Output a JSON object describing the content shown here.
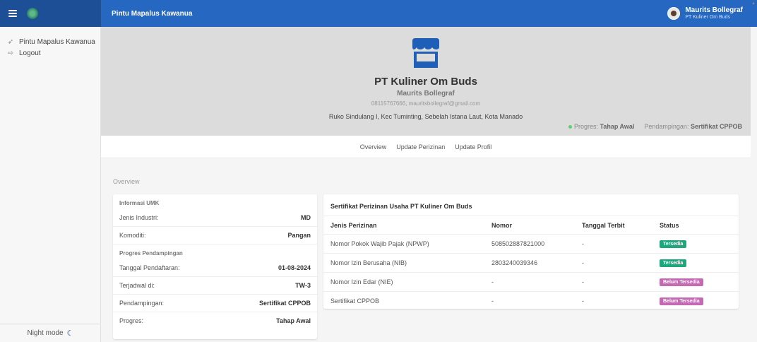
{
  "topbar": {
    "app_title": "Pintu Mapalus Kawanua",
    "user_name": "Maurits Bollegraf",
    "user_company": "PT Kuliner Om Buds"
  },
  "sidebar": {
    "items": [
      {
        "label": "Pintu Mapalus Kawanua",
        "icon": "rocket-icon"
      },
      {
        "label": "Logout",
        "icon": "logout-icon"
      }
    ],
    "night_mode": "Night mode"
  },
  "profile": {
    "company_name": "PT Kuliner Om Buds",
    "owner_name": "Maurits Bollegraf",
    "contact": "08115767666, mauritsbollegraf@gmail.com",
    "address": "Ruko Sindulang I, Kec Tuminting, Sebelah Istana Laut, Kota Manado",
    "progress_label": "Progres:",
    "progress_value": "Tahap Awal",
    "assist_label": "Pendampingan:",
    "assist_value": "Sertifikat CPPOB"
  },
  "tabs": [
    "Overview",
    "Update Perizinan",
    "Update Profil"
  ],
  "overview": {
    "title": "Overview",
    "umk_head": "Informasi UMK",
    "umk_rows": [
      {
        "label": "Jenis Industri:",
        "value": "MD"
      },
      {
        "label": "Komoditi:",
        "value": "Pangan"
      }
    ],
    "progress_head": "Progres Pendampingan",
    "progress_rows": [
      {
        "label": "Tanggal Pendaftaran:",
        "value": "01-08-2024"
      },
      {
        "label": "Terjadwal di:",
        "value": "TW-3"
      },
      {
        "label": "Pendampingan:",
        "value": "Sertifikat CPPOB"
      },
      {
        "label": "Progres:",
        "value": "Tahap Awal"
      }
    ]
  },
  "certificates": {
    "title": "Sertifikat Perizinan Usaha PT Kuliner Om Buds",
    "columns": [
      "Jenis Perizinan",
      "Nomor",
      "Tanggal Terbit",
      "Status"
    ],
    "rows": [
      {
        "jenis": "Nomor Pokok Wajib Pajak (NPWP)",
        "nomor": "508502887821000",
        "tanggal": "-",
        "status": "Tersedia",
        "ok": true
      },
      {
        "jenis": "Nomor Izin Berusaha (NIB)",
        "nomor": "2803240039346",
        "tanggal": "-",
        "status": "Tersedia",
        "ok": true
      },
      {
        "jenis": "Nomor Izin Edar (NIE)",
        "nomor": "-",
        "tanggal": "-",
        "status": "Belum Tersedia",
        "ok": false
      },
      {
        "jenis": "Sertifikat CPPOB",
        "nomor": "-",
        "tanggal": "-",
        "status": "Belum Tersedia",
        "ok": false
      }
    ]
  },
  "colors": {
    "topbar_dark": "#1c4f95",
    "topbar": "#2668c1",
    "header_bg": "#dcdcdc",
    "badge_ok": "#1ea67c",
    "badge_no": "#c46ab2"
  }
}
